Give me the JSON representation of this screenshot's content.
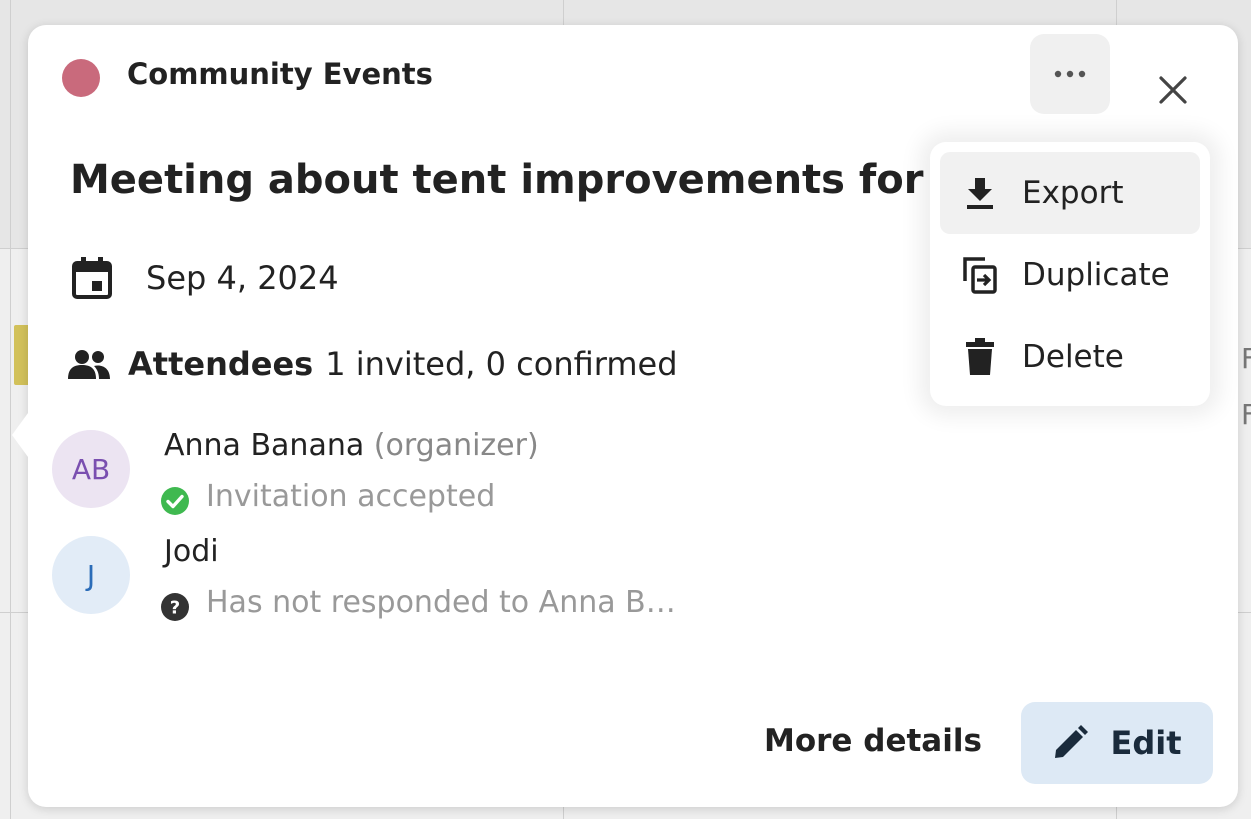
{
  "popover": {
    "calendar_name": "Community Events",
    "calendar_color": "#c96a7c",
    "event_title": "Meeting about tent improvements for LIn",
    "date": "Sep 4, 2024",
    "attendees_label": "Attendees",
    "attendees_summary": "1 invited, 0 confirmed",
    "attendees": [
      {
        "initials": "AB",
        "name": "Anna Banana",
        "role": "(organizer)",
        "status": "Invitation accepted",
        "status_icon": "check-circle-icon",
        "avatar_bg": "#ece4f2",
        "avatar_fg": "#7a4fb0"
      },
      {
        "initials": "J",
        "name": "Jodi",
        "role": "",
        "status": "Has not responded to Anna B…",
        "status_icon": "question-circle-icon",
        "avatar_bg": "#e2ecf7",
        "avatar_fg": "#2b6cb8"
      }
    ],
    "more_details_label": "More details",
    "edit_label": "Edit"
  },
  "menu": {
    "items": [
      {
        "label": "Export",
        "icon": "download-icon"
      },
      {
        "label": "Duplicate",
        "icon": "duplicate-icon"
      },
      {
        "label": "Delete",
        "icon": "trash-icon"
      }
    ]
  },
  "background": {
    "edge_letters": [
      "F",
      "F"
    ]
  }
}
